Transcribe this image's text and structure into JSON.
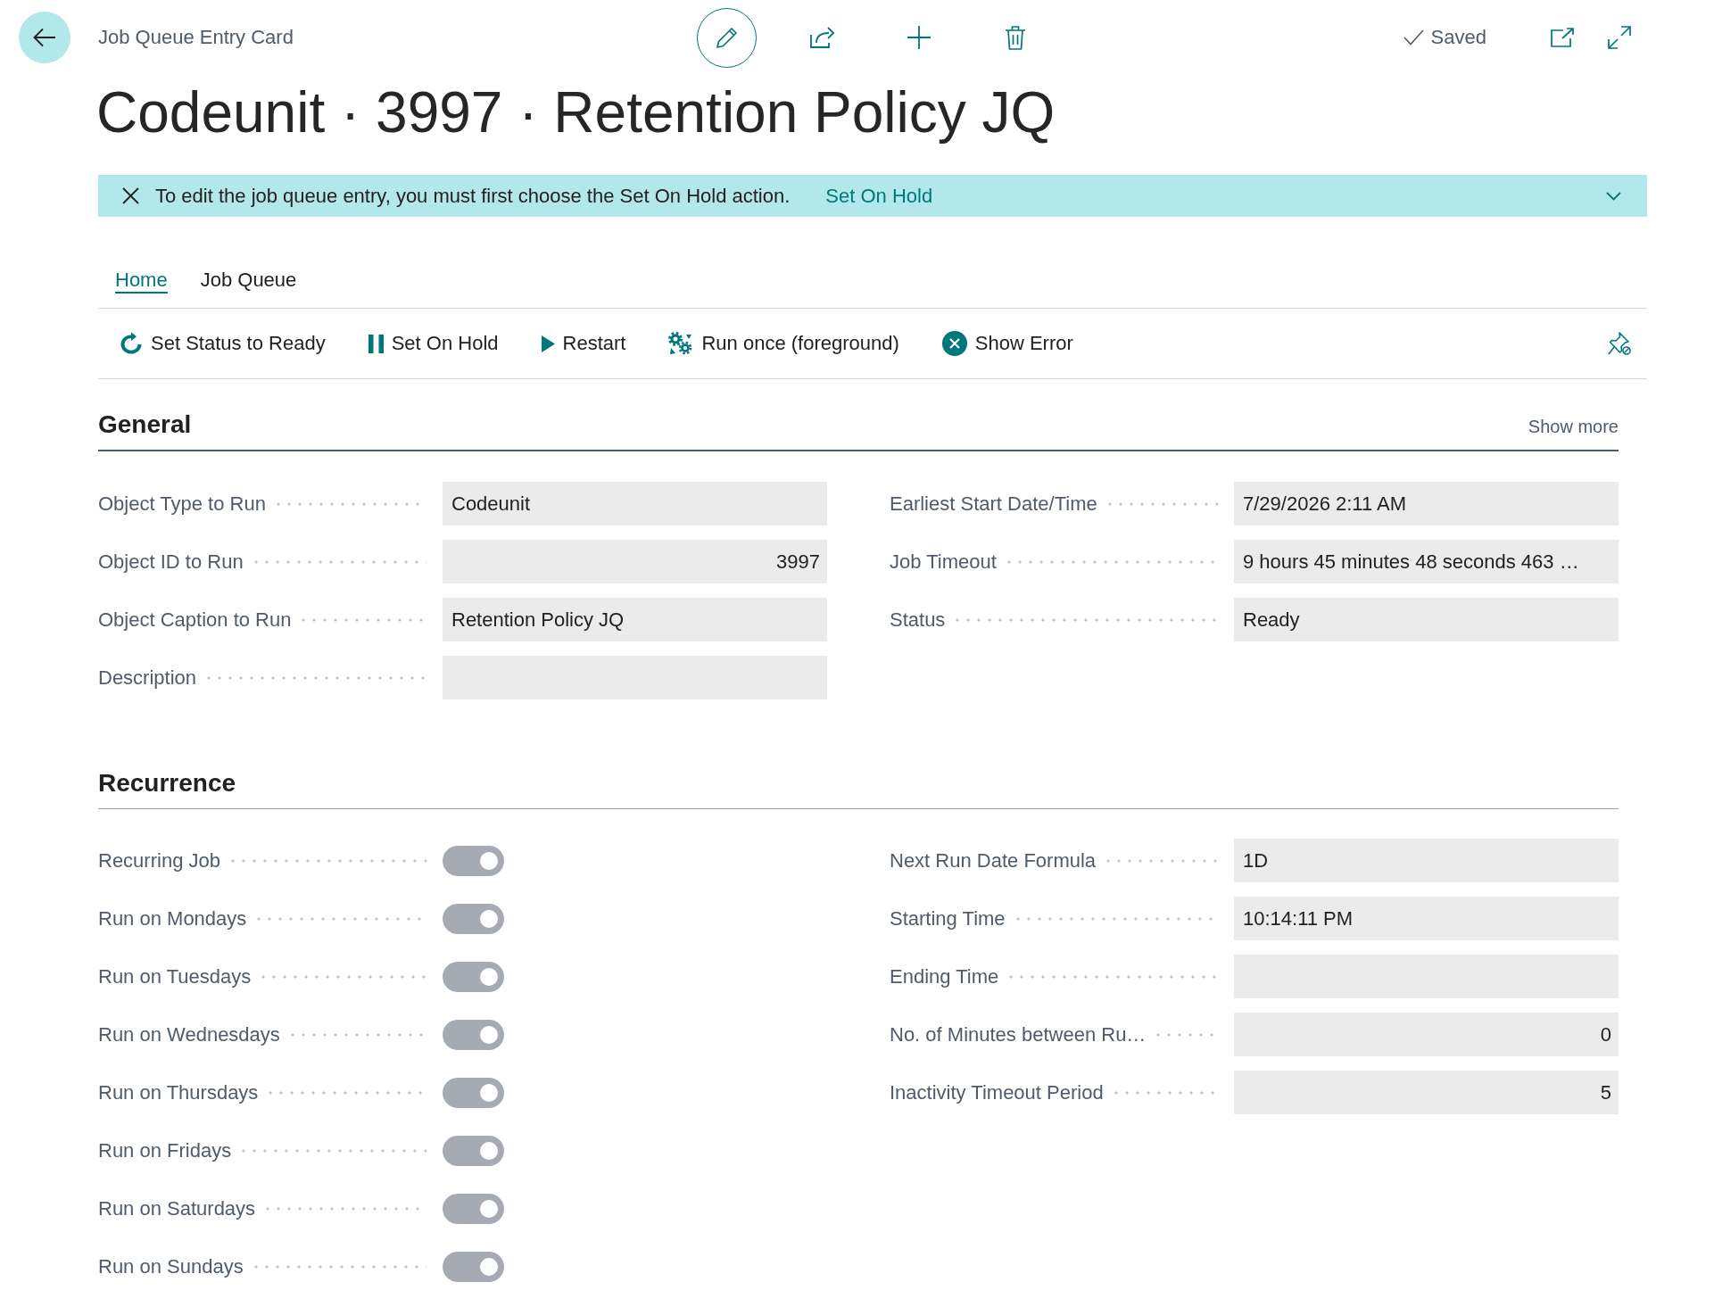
{
  "topbar": {
    "breadcrumb": "Job Queue Entry Card",
    "status": "Saved"
  },
  "title": "Codeunit · 3997 · Retention Policy JQ",
  "notification": {
    "message": "To edit the job queue entry, you must first choose the Set On Hold action.",
    "action": "Set On Hold"
  },
  "tabs": [
    {
      "label": "Home",
      "selected": true
    },
    {
      "label": "Job Queue",
      "selected": false
    }
  ],
  "actions": [
    {
      "kind": "ready",
      "label": "Set Status to Ready"
    },
    {
      "kind": "hold",
      "label": "Set On Hold"
    },
    {
      "kind": "restart",
      "label": "Restart"
    },
    {
      "kind": "run",
      "label": "Run once (foreground)"
    },
    {
      "kind": "error",
      "label": "Show Error"
    }
  ],
  "sections": [
    {
      "title": "General",
      "active": true,
      "show_more": "Show more",
      "left": [
        {
          "label": "Object Type to Run",
          "kind": "text",
          "value": "Codeunit"
        },
        {
          "label": "Object ID to Run",
          "kind": "number",
          "value": "3997"
        },
        {
          "label": "Object Caption to Run",
          "kind": "text",
          "value": "Retention Policy JQ"
        },
        {
          "label": "Description",
          "kind": "text"
        }
      ],
      "right": [
        {
          "label": "Earliest Start Date/Time",
          "kind": "text",
          "value": "7/29/2026 2:11 AM"
        },
        {
          "label": "Job Timeout",
          "kind": "text",
          "value": "9 hours 45 minutes 48 seconds 463 …"
        },
        {
          "label": "Status",
          "kind": "text",
          "value": "Ready"
        }
      ]
    },
    {
      "title": "Recurrence",
      "active": false,
      "left": [
        {
          "label": "Recurring Job",
          "kind": "toggle",
          "on": true
        },
        {
          "label": "Run on Mondays",
          "kind": "toggle",
          "on": true
        },
        {
          "label": "Run on Tuesdays",
          "kind": "toggle",
          "on": true
        },
        {
          "label": "Run on Wednesdays",
          "kind": "toggle",
          "on": true
        },
        {
          "label": "Run on Thursdays",
          "kind": "toggle",
          "on": true
        },
        {
          "label": "Run on Fridays",
          "kind": "toggle",
          "on": true
        },
        {
          "label": "Run on Saturdays",
          "kind": "toggle",
          "on": true
        },
        {
          "label": "Run on Sundays",
          "kind": "toggle",
          "on": true
        }
      ],
      "right": [
        {
          "label": "Next Run Date Formula",
          "kind": "text",
          "value": "1D"
        },
        {
          "label": "Starting Time",
          "kind": "text",
          "value": "10:14:11 PM"
        },
        {
          "label": "Ending Time",
          "kind": "text"
        },
        {
          "label": "No. of Minutes between Ru…",
          "kind": "number",
          "value": "0"
        },
        {
          "label": "Inactivity Timeout Period",
          "kind": "number",
          "value": "5"
        }
      ]
    }
  ]
}
